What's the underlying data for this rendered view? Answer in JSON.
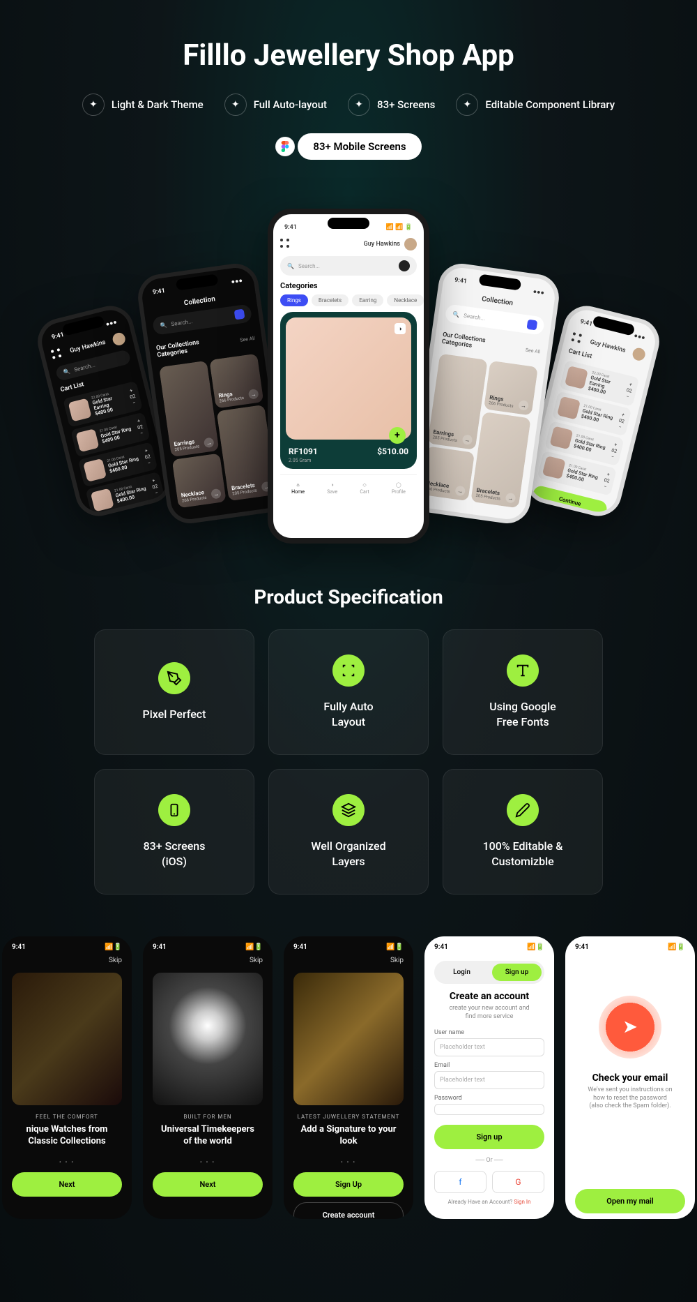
{
  "hero": {
    "title": "Filllo Jewellery Shop App",
    "features": [
      "Light & Dark Theme",
      "Full Auto-layout",
      "83+ Screens",
      "Editable Component Library"
    ],
    "screens_pill": "83+ Mobile Screens"
  },
  "center_phone": {
    "time": "9:41",
    "user": "Guy Hawkins",
    "search_placeholder": "Search...",
    "categories_label": "Categories",
    "tabs": [
      "Rings",
      "Bracelets",
      "Earring",
      "Necklace"
    ],
    "product": {
      "sku": "RF1091",
      "weight": "2.05 Gram",
      "price": "$510.00"
    },
    "nav": [
      "Home",
      "Save",
      "Cart",
      "Profile"
    ]
  },
  "collection_phone": {
    "title": "Collection",
    "search_placeholder": "Search...",
    "header": "Our Collections Categories",
    "see_all": "See All",
    "items": [
      {
        "name": "Earrings",
        "count": "205 Products"
      },
      {
        "name": "Rings",
        "count": "266 Products"
      },
      {
        "name": "Bracelets",
        "count": "205 Products"
      },
      {
        "name": "Necklace",
        "count": "266 Products"
      }
    ]
  },
  "cart_phone": {
    "user": "Guy Hawkins",
    "title": "Cart List",
    "search_placeholder": "Search...",
    "items": [
      {
        "karat": "22.00 Carat",
        "name": "Gold Star Earring",
        "price": "$400.00",
        "qty": "02"
      },
      {
        "karat": "21.00 Carat",
        "name": "Gold Star Ring",
        "price": "$400.00",
        "qty": "02"
      },
      {
        "karat": "21.00 Carat",
        "name": "Gold Star Ring",
        "price": "$400.00",
        "qty": "02"
      },
      {
        "karat": "21.00 Carat",
        "name": "Gold Star Ring",
        "price": "$400.00",
        "qty": "02"
      }
    ],
    "continue": "Continue"
  },
  "specs": {
    "title": "Product Specification",
    "items": [
      {
        "label": "Pixel Perfect",
        "icon": "pen"
      },
      {
        "label": "Fully Auto\nLayout",
        "icon": "frame"
      },
      {
        "label": "Using Google\nFree Fonts",
        "icon": "type"
      },
      {
        "label": "83+ Screens\n(iOS)",
        "icon": "device"
      },
      {
        "label": "Well Organized\nLayers",
        "icon": "layers"
      },
      {
        "label": "100% Editable &\nCustomizble",
        "icon": "edit"
      }
    ]
  },
  "gallery": [
    {
      "theme": "dark",
      "type": "onboard",
      "time": "9:41",
      "skip": "Skip",
      "kicker": "FEEL THE COMFORT",
      "headline": "nique Watches from Classic Collections",
      "btn": "Next",
      "img": "gold"
    },
    {
      "theme": "dark",
      "type": "onboard",
      "time": "9:41",
      "skip": "Skip",
      "kicker": "BUILT FOR MEN",
      "headline": "Universal Timekeepers of the world",
      "btn": "Next",
      "img": "diamond"
    },
    {
      "theme": "dark",
      "type": "onboard-signup",
      "time": "9:41",
      "skip": "Skip",
      "kicker": "LATEST JUWELLERY STATEMENT",
      "headline": "Add a Signature to your look",
      "btn1": "Sign Up",
      "btn2": "Create account",
      "img": "ring"
    },
    {
      "theme": "light",
      "type": "auth",
      "time": "9:41",
      "tabs": [
        "Login",
        "Sign up"
      ],
      "title": "Create an account",
      "sub": "create your new account and find more service",
      "fields": [
        {
          "label": "User name",
          "placeholder": "Placeholder text"
        },
        {
          "label": "Email",
          "placeholder": "Placeholder text"
        },
        {
          "label": "Password",
          "placeholder": ""
        }
      ],
      "btn": "Sign up",
      "or": "Or",
      "already": "Already Have an Account?",
      "signin": "Sign In"
    },
    {
      "theme": "light",
      "type": "check-email",
      "time": "9:41",
      "title": "Check your email",
      "sub": "We've sent you instructions on how to reset the password (also check the Spam folder).",
      "btn": "Open my mail"
    }
  ]
}
